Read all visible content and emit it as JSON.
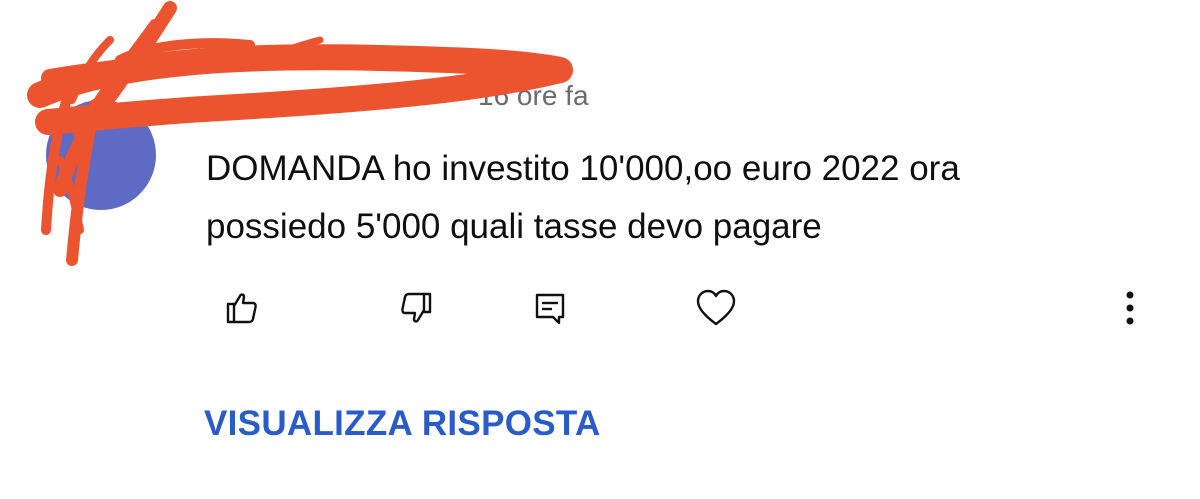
{
  "comment": {
    "timestamp": "16 ore fa",
    "text_line1": "DOMANDA ho investito 10'000,oo euro 2022 ora",
    "text_line2": "possiedo 5'000 quali tasse devo pagare"
  },
  "actions": {
    "like_icon": "thumb-up-icon",
    "dislike_icon": "thumb-down-icon",
    "reply_icon": "comment-reply-icon",
    "heart_icon": "heart-icon",
    "more_icon": "more-vertical-icon"
  },
  "replies": {
    "view_label": "VISUALIZZA RISPOSTA"
  },
  "colors": {
    "avatar": "#5e6bc4",
    "scribble": "#ec5430",
    "link": "#2a5cc8",
    "meta_text": "#6b6b6b"
  }
}
